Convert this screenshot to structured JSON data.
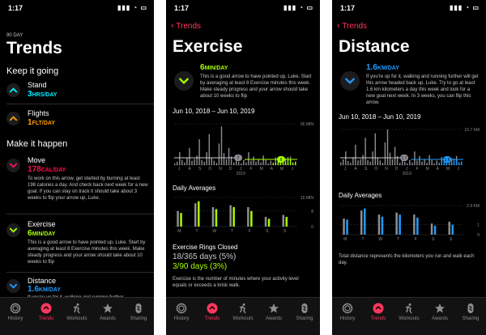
{
  "colors": {
    "move": "#fa114f",
    "exercise": "#a6ff00",
    "stand": "#00f0ff",
    "flights": "#ff9f0a",
    "distance": "#1e9cff",
    "accent": "#ff375f"
  },
  "status": {
    "time": "1:17",
    "icons": "▮▮▮ ◔ ▭"
  },
  "tabs": [
    "History",
    "Trends",
    "Workouts",
    "Awards",
    "Sharing"
  ],
  "trends": {
    "eyebrow": "90 DAY",
    "title": "Trends",
    "keep_going": "Keep it going",
    "make_happen": "Make it happen",
    "stand": {
      "label": "Stand",
      "value": "3",
      "unit": "HRS/DAY"
    },
    "flights": {
      "label": "Flights",
      "value": "1",
      "unit": "FLT/DAY"
    },
    "move": {
      "label": "Move",
      "value": "178",
      "unit": "CAL/DAY",
      "desc": "To work on this arrow, get started by burning at least 198 calories a day. And check back next week for a new goal. If you can stay on track it should take about 3 weeks to flip your arrow up, Luke."
    },
    "exercise": {
      "label": "Exercise",
      "value": "6",
      "unit": "MIN/DAY",
      "desc": "This is a good arrow to have pointed up, Luke. Start by averaging at least 8 Exercise minutes this week. Make steady progress and your arrow should take about 10 weeks to flip"
    },
    "distance": {
      "label": "Distance",
      "value": "1.6",
      "unit": "KM/DAY",
      "desc": "If you're up for it, walking and running further"
    }
  },
  "exercise": {
    "back": "Trends",
    "title": "Exercise",
    "value": "6",
    "unit": "MIN/DAY",
    "desc": "This is a good arrow to have pointed up, Luke. Start by averaging at least 8 Exercise minutes this week. Make steady progress and your arrow should take about 10 weeks to flip",
    "range": "Jun 10, 2018 – Jun 10, 2019",
    "max_label": "96 MIN",
    "year_label": "2019",
    "badge_a": "7",
    "badge_b": "6",
    "daily_title": "Daily Averages",
    "daily_max": "15 MIN",
    "daily_mid": "8",
    "daily_zero": "0",
    "rings_title": "Exercise Rings Closed",
    "rings_a": "18/365 days (5%)",
    "rings_b": "3/90 days (3%)",
    "footer": "Exercise is the number of minutes where your activity level equals or exceeds a brisk walk."
  },
  "distance": {
    "back": "Trends",
    "title": "Distance",
    "value": "1.6",
    "unit": "KM/DAY",
    "desc": "If you're up for it, walking and running further will get this arrow headed back up, Luke. Try to go at least 1.6 km kilometers a day this week and look for a new goal next week. In 3 weeks, you can flip this arrow.",
    "range": "Jun 10, 2018 – Jun 10, 2019",
    "max_label": "15.7 KM",
    "year_label": "2019",
    "badge_a": "1.7",
    "badge_b": "1.6",
    "daily_title": "Daily Averages",
    "daily_max": "2.9 KM",
    "daily_mid": "1",
    "daily_zero": "0",
    "footer": "Total distance represents the kilometers you run and walk each day."
  },
  "months": [
    "J",
    "A",
    "S",
    "O",
    "N",
    "D",
    "J",
    "F",
    "M",
    "A",
    "M",
    "J"
  ],
  "weekdays": [
    "M",
    "T",
    "W",
    "T",
    "F",
    "S",
    "S"
  ],
  "chart_data": [
    {
      "type": "bar",
      "title": "Exercise – Jun 10, 2018 – Jun 10, 2019",
      "ylim": [
        0,
        96
      ],
      "values": [
        4,
        8,
        30,
        12,
        6,
        18,
        40,
        10,
        14,
        22,
        60,
        12,
        8,
        30,
        72,
        16,
        10,
        5,
        50,
        90,
        28,
        14,
        40,
        20,
        6,
        10,
        8,
        4,
        12,
        6,
        30,
        10,
        20,
        8,
        14,
        6,
        22,
        12,
        4,
        10,
        6,
        18,
        8,
        12,
        6,
        16,
        4,
        20,
        6,
        8
      ],
      "series": [
        {
          "name": "overlay",
          "values": [
            4,
            6,
            10,
            14,
            6,
            8,
            18,
            12,
            6,
            8
          ]
        }
      ]
    },
    {
      "type": "bar",
      "title": "Exercise Daily Averages",
      "categories": [
        "M",
        "T",
        "W",
        "T",
        "F",
        "S",
        "S"
      ],
      "ylim": [
        0,
        15
      ],
      "series": [
        {
          "name": "grey",
          "values": [
            8,
            12,
            10,
            11,
            10,
            5,
            6
          ]
        },
        {
          "name": "green",
          "values": [
            7,
            13,
            9,
            10,
            8,
            4,
            5
          ]
        }
      ]
    },
    {
      "type": "bar",
      "title": "Distance – Jun 10, 2018 – Jun 10, 2019",
      "ylim": [
        0,
        15.7
      ],
      "values": [
        1.2,
        2.5,
        6,
        1.8,
        1,
        3.5,
        9,
        2,
        2.6,
        4.5,
        12,
        2.2,
        1.5,
        6,
        14,
        3,
        2,
        1,
        10,
        15.7,
        5.5,
        2.6,
        8,
        4,
        1,
        2,
        1.5,
        0.8,
        2.2,
        1.1,
        6,
        2,
        4,
        1.5,
        2.6,
        1,
        4.4,
        2.2,
        0.8,
        2,
        1,
        3.5,
        1.6,
        2.2,
        1,
        3,
        0.8,
        4,
        1.2,
        1.5
      ],
      "series": [
        {
          "name": "overlay",
          "values": [
            1.1,
            1.4,
            1.8,
            2.4,
            1.2,
            1.6,
            2.9,
            2.1,
            1.3,
            1.6
          ]
        }
      ]
    },
    {
      "type": "bar",
      "title": "Distance Daily Averages",
      "categories": [
        "M",
        "T",
        "W",
        "T",
        "F",
        "S",
        "S"
      ],
      "ylim": [
        0,
        2.9
      ],
      "series": [
        {
          "name": "grey",
          "values": [
            1.6,
            2.4,
            2.0,
            2.2,
            2.0,
            1.1,
            1.3
          ]
        },
        {
          "name": "blue",
          "values": [
            1.5,
            2.6,
            1.8,
            2.0,
            1.7,
            0.9,
            1.0
          ]
        }
      ]
    }
  ]
}
